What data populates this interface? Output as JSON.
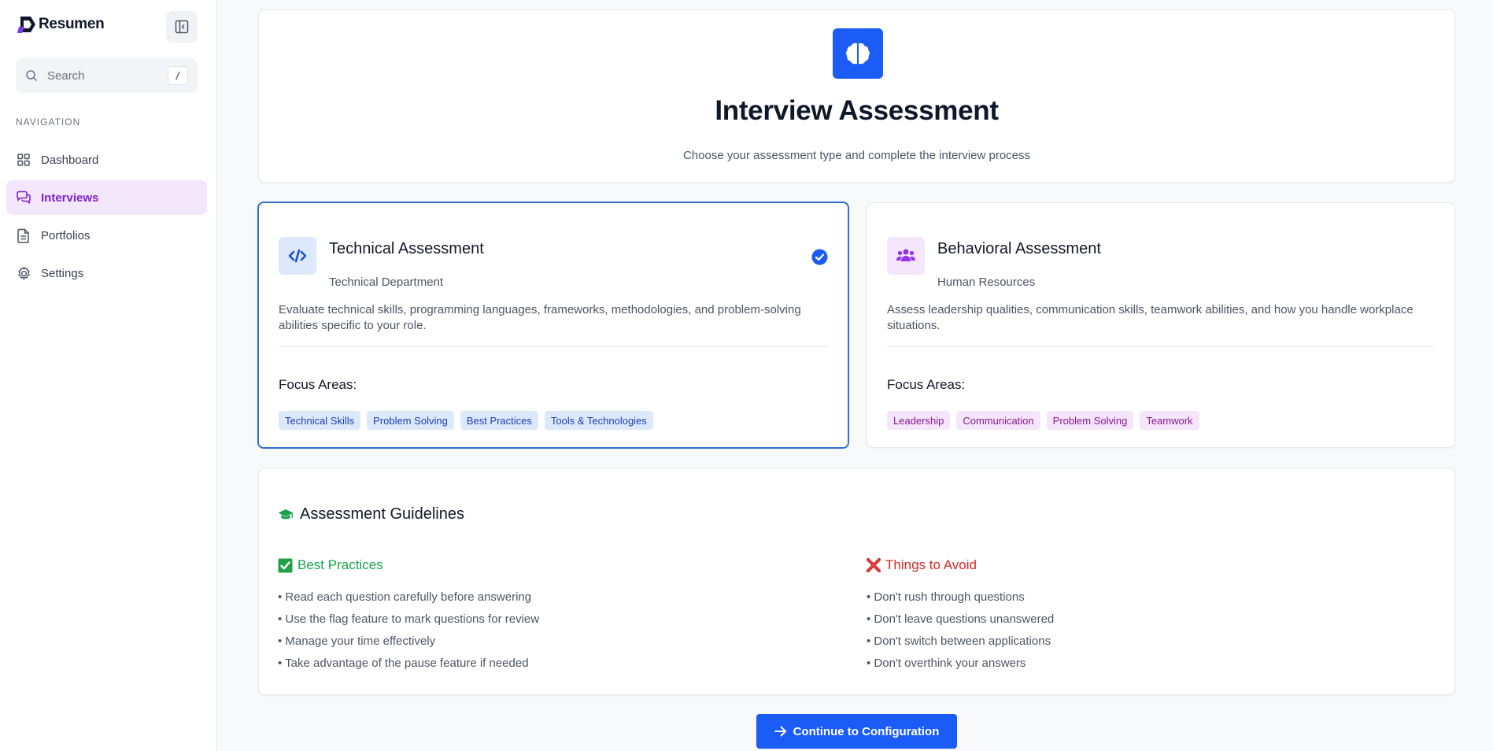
{
  "brand": {
    "name": "Resumen"
  },
  "search": {
    "placeholder": "Search",
    "shortcut": "/"
  },
  "sidebar": {
    "section_label": "NAVIGATION",
    "items": [
      {
        "label": "Dashboard",
        "icon": "grid-icon",
        "active": false
      },
      {
        "label": "Interviews",
        "icon": "chat-icon",
        "active": true
      },
      {
        "label": "Portfolios",
        "icon": "document-icon",
        "active": false
      },
      {
        "label": "Settings",
        "icon": "gear-icon",
        "active": false
      }
    ]
  },
  "hero": {
    "icon": "brain-icon",
    "title": "Interview Assessment",
    "subtitle": "Choose your assessment type and complete the interview process"
  },
  "assessments": [
    {
      "title": "Technical Assessment",
      "department": "Technical Department",
      "description": "Evaluate technical skills, programming languages, frameworks, methodologies, and problem-solving abilities specific to your role.",
      "focus_label": "Focus Areas:",
      "tags": [
        "Technical Skills",
        "Problem Solving",
        "Best Practices",
        "Tools & Technologies"
      ],
      "icon": "code-icon",
      "selected": true
    },
    {
      "title": "Behavioral Assessment",
      "department": "Human Resources",
      "description": "Assess leadership qualities, communication skills, teamwork abilities, and how you handle workplace situations.",
      "focus_label": "Focus Areas:",
      "tags": [
        "Leadership",
        "Communication",
        "Problem Solving",
        "Teamwork"
      ],
      "icon": "users-icon",
      "selected": false
    }
  ],
  "guidelines": {
    "title": "Assessment Guidelines",
    "best": {
      "title": "Best Practices",
      "items": [
        "• Read each question carefully before answering",
        "• Use the flag feature to mark questions for review",
        "• Manage your time effectively",
        "• Take advantage of the pause feature if needed"
      ]
    },
    "avoid": {
      "title": "Things to Avoid",
      "items": [
        "• Don't rush through questions",
        "• Don't leave questions unanswered",
        "• Don't switch between applications",
        "• Don't overthink your answers"
      ]
    }
  },
  "cta": {
    "label": "Continue to Configuration"
  },
  "colors": {
    "primary": "#1a5cf5",
    "accent_purple": "#7e22ce",
    "success": "#16a34a",
    "danger": "#dc2626"
  }
}
